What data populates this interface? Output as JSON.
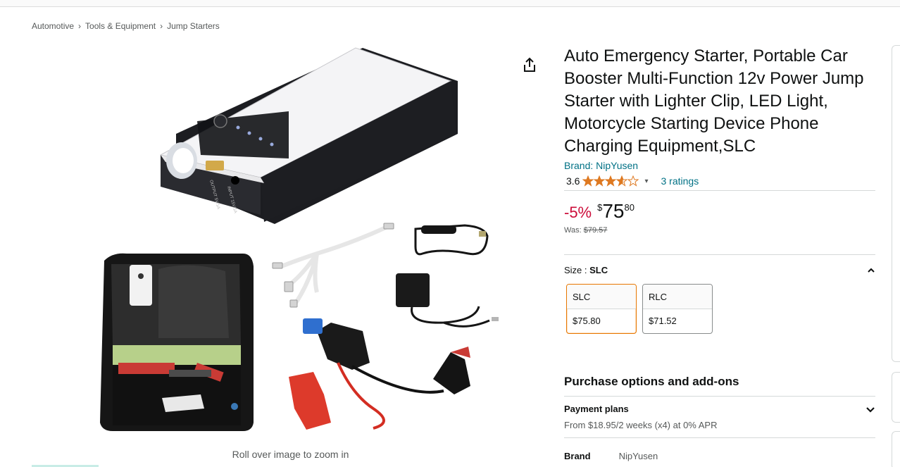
{
  "breadcrumb": [
    "Automotive",
    "Tools & Equipment",
    "Jump Starters"
  ],
  "breadcrumb_separator": "›",
  "image": {
    "zoom_hint": "Roll over image to zoom in",
    "power_bank_port_label_1": "OUTPUT 5V/1A",
    "power_bank_port_label_2": "INPUT 15V/1A"
  },
  "product": {
    "title": "Auto Emergency Starter, Portable Car Booster Multi-Function 12v Power Jump Starter with Lighter Clip, LED Light, Motorcycle Starting Device Phone Charging Equipment,SLC",
    "brand": "Brand: NipYusen",
    "rating": "3.6",
    "stars_filled": 3.6,
    "stars_total": 5,
    "ratings_link": "3 ratings",
    "discount": "-5%",
    "price_symbol": "$",
    "price_whole": "75",
    "price_fraction": "80",
    "was_label": "Was:",
    "was_price": "$79.57"
  },
  "size": {
    "label": "Size :",
    "selected": "SLC",
    "options": [
      {
        "name": "SLC",
        "price": "$75.80"
      },
      {
        "name": "RLC",
        "price": "$71.52"
      }
    ]
  },
  "purchase": {
    "title": "Purchase options and add-ons",
    "payment_plans": "Payment plans",
    "payment_sub": "From $18.95/2 weeks (x4) at 0% APR",
    "next_label": "Brand",
    "next_value": "NipYusen"
  },
  "colors": {
    "link": "#007185",
    "discount": "#cc0c39",
    "star": "#de7921",
    "selected_border": "#e77600"
  }
}
